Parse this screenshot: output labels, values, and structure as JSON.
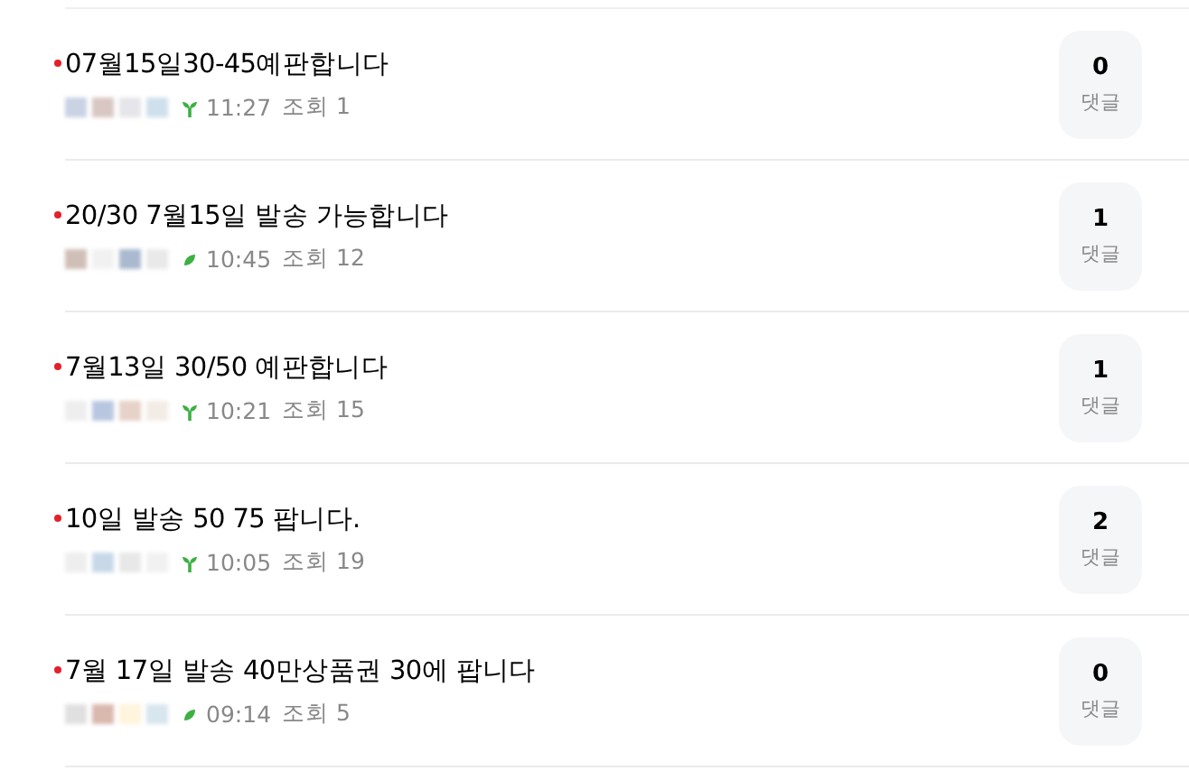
{
  "posts": [
    {
      "title": "07월15일30-45예판합니다",
      "new": true,
      "member_badge": {
        "kind": "sprout"
      },
      "time": "11:27",
      "views_label": "조회",
      "views": "1",
      "comments": "0",
      "comments_label": "댓글"
    },
    {
      "title": "20/30 7월15일 발송 가능합니다",
      "new": true,
      "member_badge": {
        "kind": "leaf"
      },
      "time": "10:45",
      "views_label": "조회",
      "views": "12",
      "comments": "1",
      "comments_label": "댓글"
    },
    {
      "title": "7월13일 30/50 예판합니다",
      "new": true,
      "member_badge": {
        "kind": "sprout"
      },
      "time": "10:21",
      "views_label": "조회",
      "views": "15",
      "comments": "1",
      "comments_label": "댓글"
    },
    {
      "title": "10일 발송 50 75 팝니다.",
      "new": true,
      "member_badge": {
        "kind": "sprout"
      },
      "time": "10:05",
      "views_label": "조회",
      "views": "19",
      "comments": "2",
      "comments_label": "댓글"
    },
    {
      "title": "7월 17일 발송 40만상품권 30에 팝니다",
      "new": true,
      "member_badge": {
        "kind": "leaf"
      },
      "time": "09:14",
      "views_label": "조회",
      "views": "5",
      "comments": "0",
      "comments_label": "댓글"
    }
  ]
}
